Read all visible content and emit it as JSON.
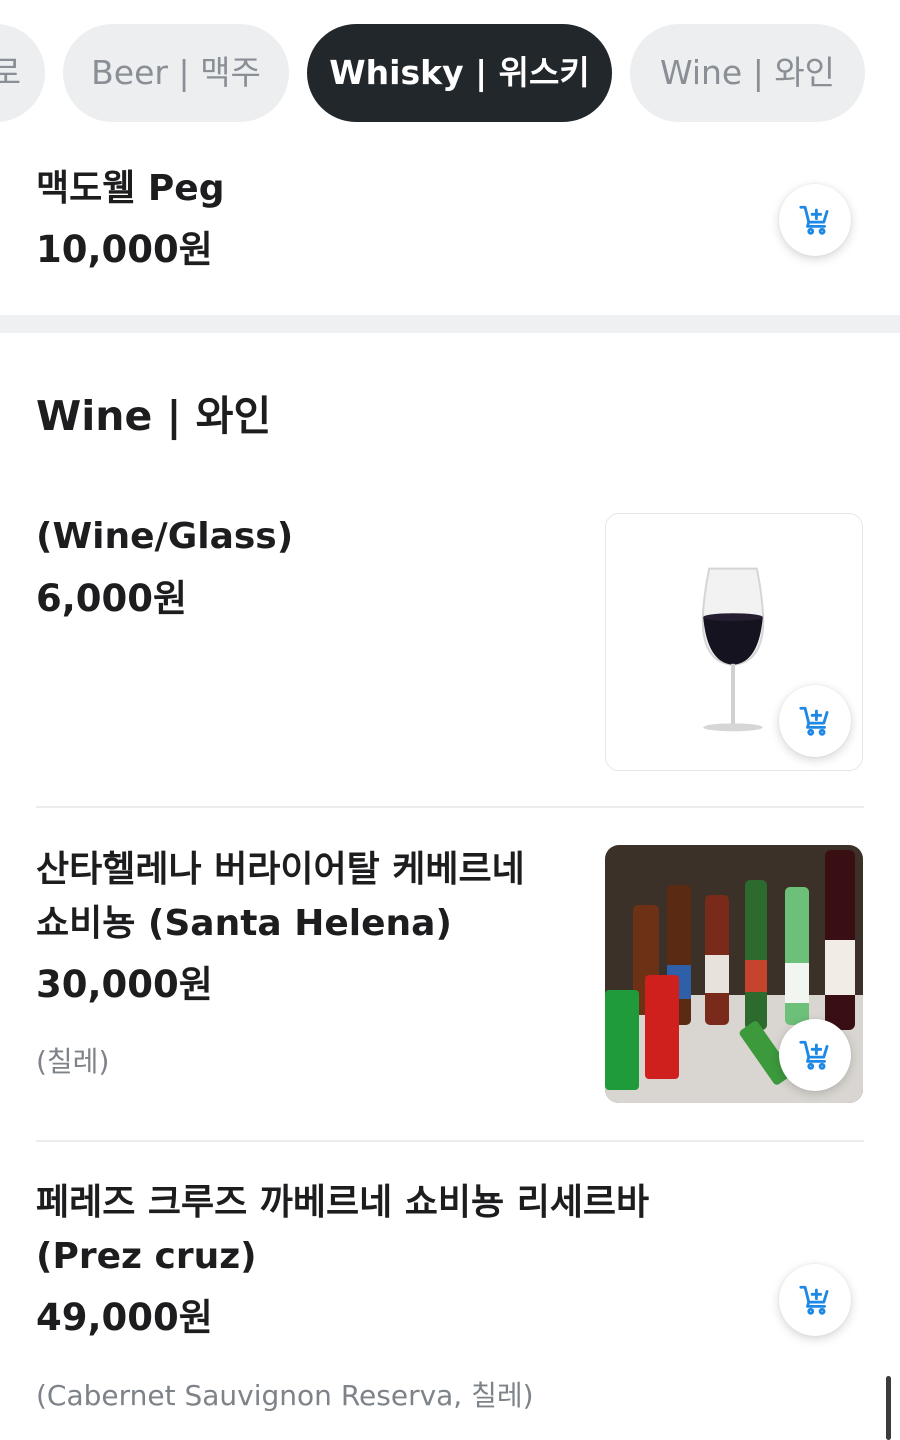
{
  "tabs": {
    "prev_fragment": "로",
    "beer": "Beer | 맥주",
    "whisky": "Whisky | 위스키",
    "wine": "Wine | 와인"
  },
  "active_tab": "whisky",
  "whisky_tail_item": {
    "name": "맥도웰 Peg",
    "price": "10,000원"
  },
  "wine_section": {
    "title": "Wine | 와인",
    "items": [
      {
        "name": "(Wine/Glass)",
        "price": "6,000원",
        "image": "wine-glass"
      },
      {
        "name_line1": "산타헬레나 버라이어탈 케베르네",
        "name_line2": "쇼비뇽 (Santa Helena)",
        "price": "30,000원",
        "desc": "(칠레)",
        "image": "assorted-drinks-bottles"
      },
      {
        "name_line1": "페레즈 크루즈 까베르네 쇼비뇽 리세르바",
        "name_line2": "(Prez cruz)",
        "price": "49,000원",
        "desc": "(Cabernet Sauvignon Reserva, 칠레)"
      }
    ]
  },
  "colors": {
    "active_tab_bg": "#22272c",
    "inactive_tab_bg": "#eceef0",
    "cart_icon": "#1e88e5"
  },
  "icons": {
    "cart_add": "cart-plus-icon"
  }
}
